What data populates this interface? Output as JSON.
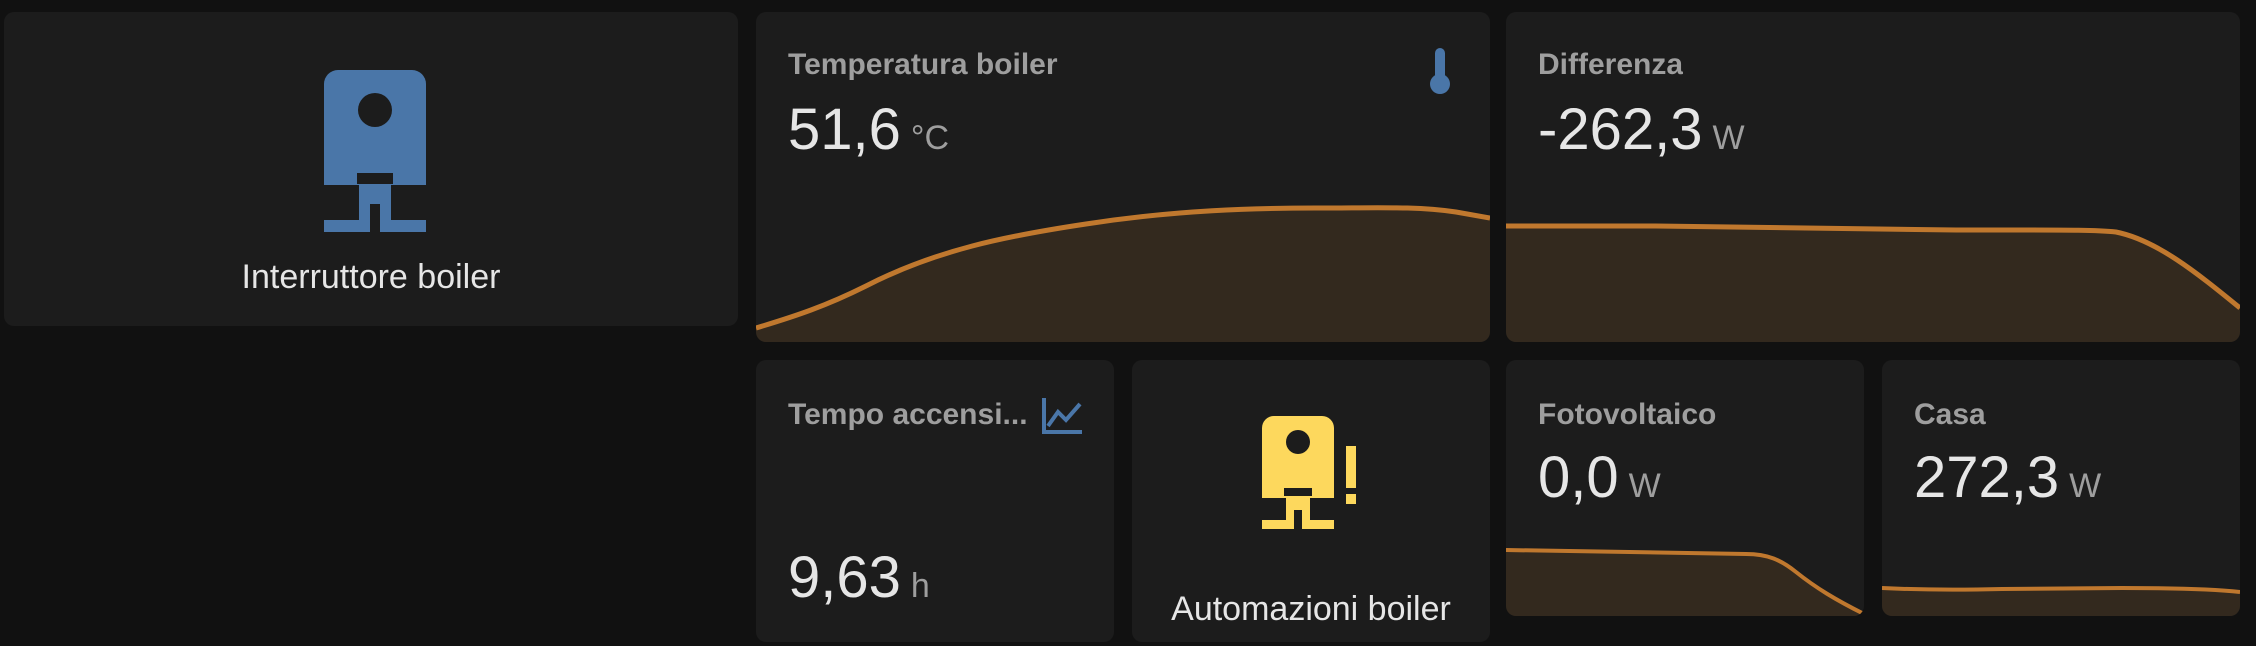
{
  "colors": {
    "background": "#111111",
    "card": "#1c1c1c",
    "boiler_blue": "#4a76a8",
    "automation_yellow": "#fdd85d",
    "graph_line": "#c0782e",
    "graph_fill": "#33291e",
    "title_grey": "#9e9e9e",
    "value_white": "#e6e6e6"
  },
  "cards": {
    "boiler_switch": {
      "label": "Interruttore boiler",
      "icon": "water-boiler-icon",
      "state": "on"
    },
    "temperature": {
      "title": "Temperatura boiler",
      "value": "51,6",
      "unit": "°C",
      "icon": "thermometer-icon"
    },
    "difference": {
      "title": "Differenza",
      "value": "-262,3",
      "unit": "W"
    },
    "on_time": {
      "title": "Tempo accensi...",
      "value": "9,63",
      "unit": "h",
      "icon": "chart-line-icon"
    },
    "automations": {
      "label": "Automazioni boiler",
      "icon": "water-boiler-alert-icon"
    },
    "photovoltaic": {
      "title": "Fotovoltaico",
      "value": "0,0",
      "unit": "W"
    },
    "house": {
      "title": "Casa",
      "value": "272,3",
      "unit": "W"
    }
  }
}
